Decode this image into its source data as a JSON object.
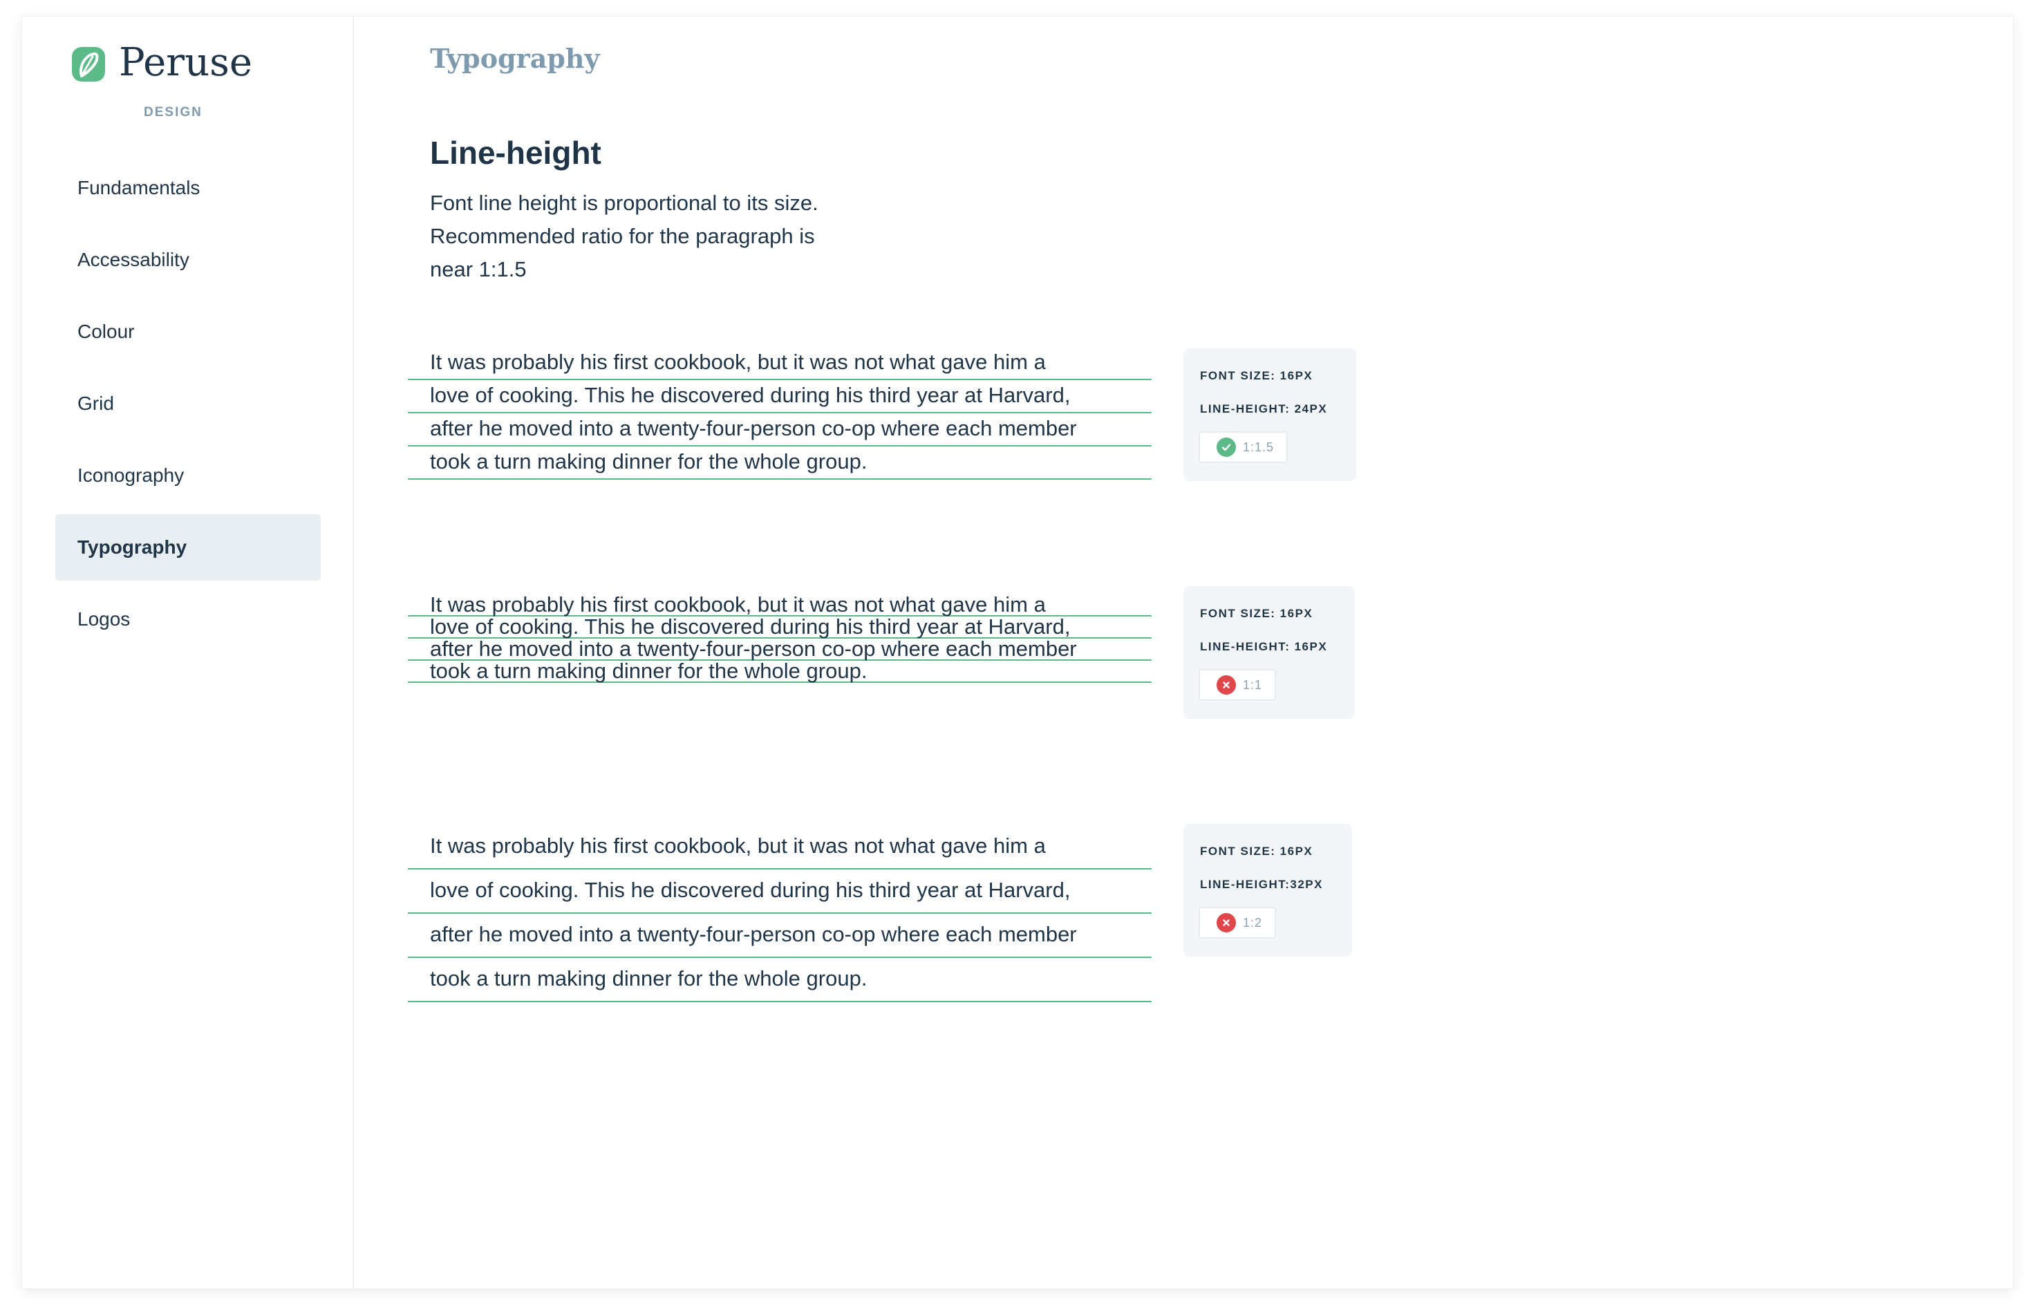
{
  "brand": {
    "name": "Peruse",
    "subtitle": "DESIGN"
  },
  "nav": [
    {
      "label": "Fundamentals",
      "active": false
    },
    {
      "label": "Accessability",
      "active": false
    },
    {
      "label": "Colour",
      "active": false
    },
    {
      "label": "Grid",
      "active": false
    },
    {
      "label": "Iconography",
      "active": false
    },
    {
      "label": "Typography",
      "active": true
    },
    {
      "label": "Logos",
      "active": false
    }
  ],
  "page": {
    "breadcrumb": "Typography",
    "heading": "Line-height",
    "description": "Font line height is proportional to its size. Recommended ratio for the paragraph is near 1:1.5"
  },
  "examples": [
    {
      "lines": [
        "It was probably his first cookbook, but it was not what gave him a",
        "love of cooking. This he discovered during his third year at Harvard,",
        "after he moved into a twenty-four-person co-op where each member",
        "took a turn making dinner for the whole group."
      ],
      "font_size_label": "FONT SIZE: 16PX",
      "line_height_label": "LINE-HEIGHT: 24PX",
      "ratio": "1:1.5",
      "status": "ok",
      "icon": "check-circle-icon"
    },
    {
      "lines": [
        "It was probably his first cookbook, but it was not what gave him a",
        "love of cooking. This he discovered during his third year at Harvard,",
        "after he moved into a twenty-four-person co-op where each member",
        "took a turn making dinner for the whole group."
      ],
      "font_size_label": "FONT SIZE: 16PX",
      "line_height_label": "LINE-HEIGHT: 16PX",
      "ratio": "1:1",
      "status": "bad",
      "icon": "x-circle-icon"
    },
    {
      "lines": [
        "It was probably his first cookbook, but it was not what gave him a",
        "love of cooking. This he discovered during his third year at Harvard,",
        "after he moved into a twenty-four-person co-op where each member",
        "took a turn making dinner for the whole group."
      ],
      "font_size_label": "FONT SIZE: 16PX",
      "line_height_label": "LINE-HEIGHT:32PX",
      "ratio": "1:2",
      "status": "bad",
      "icon": "x-circle-icon"
    }
  ],
  "colors": {
    "accent_green": "#5cba89",
    "error_red": "#e0474c",
    "text": "#1f3447",
    "muted": "#7d9aaf",
    "active_bg": "#e8eff2"
  }
}
